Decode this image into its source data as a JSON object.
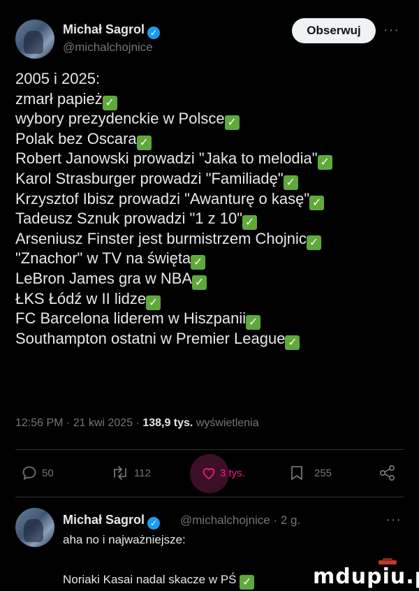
{
  "tweet": {
    "author_name": "Michał Sagrol",
    "handle": "@michalchojnice",
    "follow_label": "Obserwuj",
    "more_label": "···",
    "lines": [
      {
        "text": "2005 i 2025:",
        "check": false
      },
      {
        "text": "zmarł papież",
        "check": true
      },
      {
        "text": "wybory prezydenckie w Polsce",
        "check": true
      },
      {
        "text": "Polak bez Oscara",
        "check": true
      },
      {
        "text": "Robert Janowski prowadzi \"Jaka to melodia\"",
        "check": true
      },
      {
        "text": "Karol Strasburger prowadzi \"Familiadę\"",
        "check": true
      },
      {
        "text": "Krzysztof Ibisz prowadzi \"Awanturę o kasę\"",
        "check": true
      },
      {
        "text": "Tadeusz Sznuk prowadzi \"1 z 10\"",
        "check": true
      },
      {
        "text": "Arseniusz Finster jest burmistrzem Chojnic",
        "check": true
      },
      {
        "text": "\"Znachor\" w TV na święta",
        "check": true
      },
      {
        "text": "LeBron James gra w NBA",
        "check": true
      },
      {
        "text": "ŁKS Łódź w II lidze",
        "check": true
      },
      {
        "text": "FC Barcelona liderem w Hiszpanii",
        "check": true
      },
      {
        "text": "Southampton ostatni w Premier League",
        "check": true
      }
    ],
    "time": "12:56 PM · 21 kwi 2025 · ",
    "views_count": "138,9 tys.",
    "views_label": " wyświetlenia",
    "actions": {
      "replies": "50",
      "reposts": "112",
      "likes": "3 tys.",
      "bookmarks": "255"
    }
  },
  "reply": {
    "author_name": "Michał Sagrol",
    "meta": "@michalchojnice · 2 g.",
    "more_label": "···",
    "line1": "aha no i najważniejsze:",
    "line2": "Noriaki Kasai nadal skacze w PŚ"
  },
  "watermark": "mdupiu.pl",
  "colors": {
    "check": "#5fa93a",
    "verified": "#1d9bf0",
    "like_bg": "#3b0f26"
  }
}
